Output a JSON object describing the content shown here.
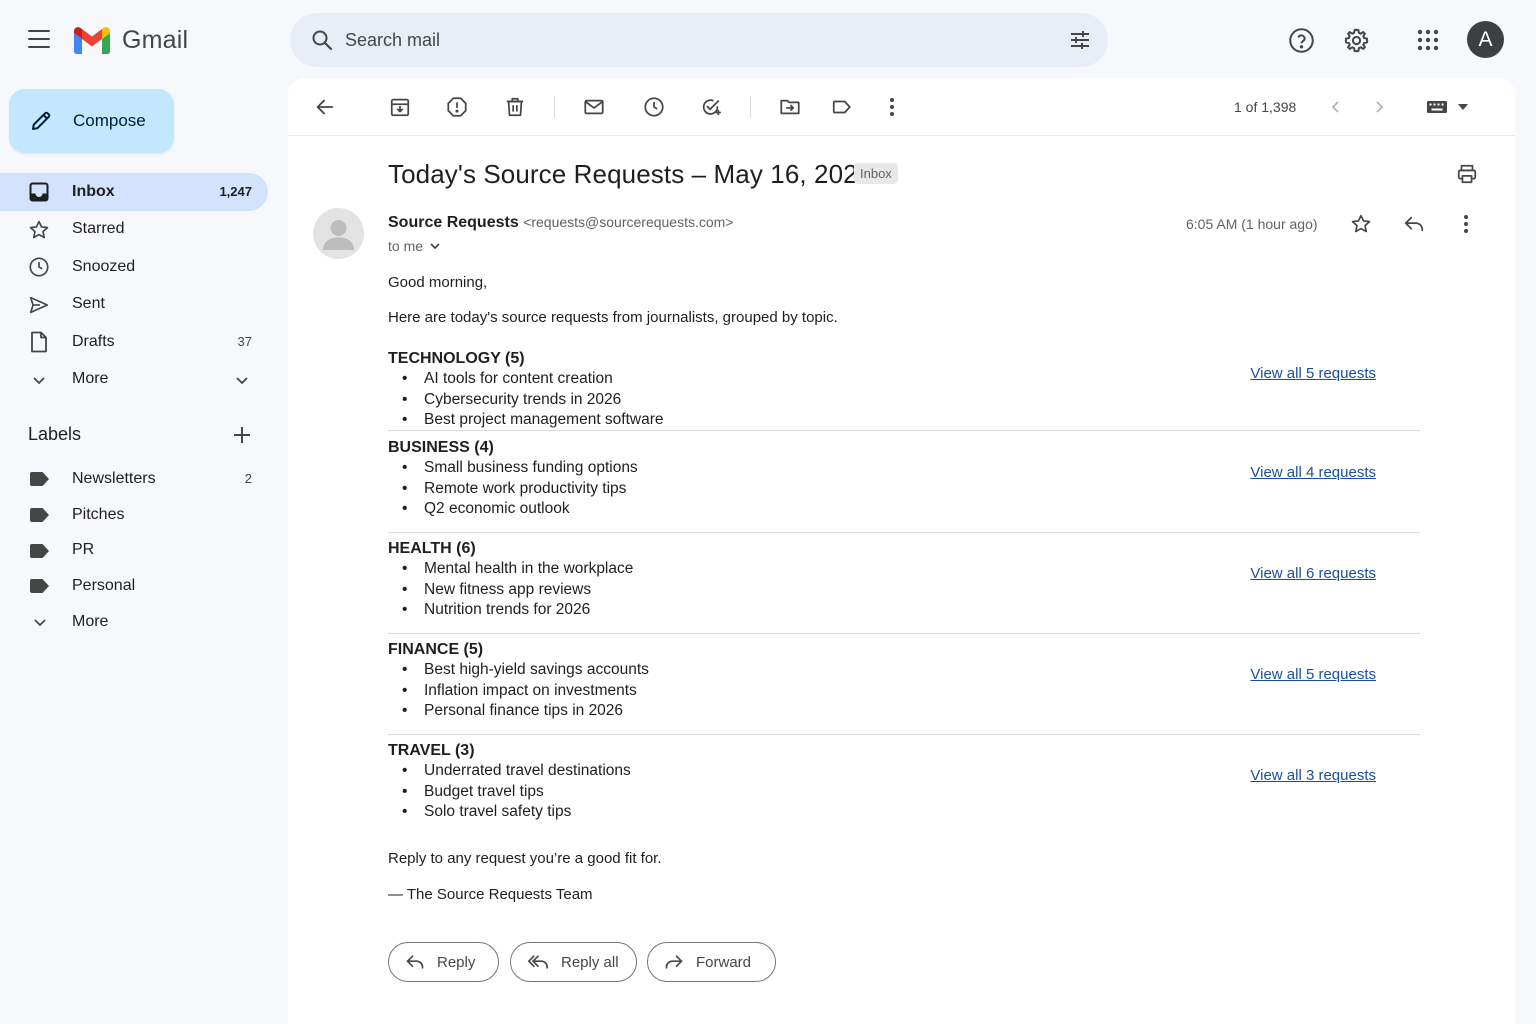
{
  "app": {
    "name": "Gmail"
  },
  "search": {
    "placeholder": "Search mail"
  },
  "account": {
    "initial": "A"
  },
  "compose": {
    "label": "Compose"
  },
  "nav": [
    {
      "name": "inbox",
      "label": "Inbox",
      "count": "1,247",
      "icon": "inbox-icon",
      "active": true
    },
    {
      "name": "starred",
      "label": "Starred",
      "count": "",
      "icon": "star-icon"
    },
    {
      "name": "snoozed",
      "label": "Snoozed",
      "count": "",
      "icon": "clock-icon"
    },
    {
      "name": "sent",
      "label": "Sent",
      "count": "",
      "icon": "send-icon"
    },
    {
      "name": "drafts",
      "label": "Drafts",
      "count": "37",
      "icon": "draft-icon"
    },
    {
      "name": "more",
      "label": "More",
      "count": "",
      "icon": "chevron-down-icon"
    }
  ],
  "labels": {
    "heading": "Labels",
    "items": [
      {
        "name": "Newsletters",
        "count": "2"
      },
      {
        "name": "Pitches",
        "count": ""
      },
      {
        "name": "PR",
        "count": ""
      },
      {
        "name": "Personal",
        "count": ""
      }
    ],
    "more": "More"
  },
  "pagination": {
    "text": "1 of 1,398"
  },
  "email": {
    "subject": "Today's Source Requests – May 16, 2026",
    "chip": "Inbox",
    "sender_name": "Source Requests",
    "sender_email": "<requests@sourcerequests.com>",
    "to": "to me",
    "time": "6:05 AM (1 hour ago)",
    "greeting": "Good morning,",
    "intro": "Here are today's source requests from journalists, grouped by topic.",
    "categories": [
      {
        "title": "TECHNOLOGY (5)",
        "items": [
          "AI tools for content creation",
          "Cybersecurity trends in 2026",
          "Best project management software"
        ],
        "link": "View all 5 requests"
      },
      {
        "title": "BUSINESS (4)",
        "items": [
          "Small business funding options",
          "Remote work productivity tips",
          "Q2 economic outlook"
        ],
        "link": "View all 4 requests"
      },
      {
        "title": "HEALTH (6)",
        "items": [
          "Mental health in the workplace",
          "New fitness app reviews",
          "Nutrition trends for 2026"
        ],
        "link": "View all 6 requests"
      },
      {
        "title": "FINANCE (5)",
        "items": [
          "Best high-yield savings accounts",
          "Inflation impact on investments",
          "Personal finance tips in 2026"
        ],
        "link": "View all 5 requests"
      },
      {
        "title": "TRAVEL (3)",
        "items": [
          "Underrated travel destinations",
          "Budget travel tips",
          "Solo travel safety tips"
        ],
        "link": "View all 3 requests"
      }
    ],
    "closing": "Reply to any request you’re a good fit for.",
    "signature": "— The Source Requests Team"
  },
  "actions": {
    "reply": "Reply",
    "reply_all": "Reply all",
    "forward": "Forward"
  },
  "colors": {
    "compose_bg": "#c2e7ff",
    "active_nav": "#d3e3fd",
    "link": "#1a4fa0",
    "background": "#f6f8fc"
  }
}
